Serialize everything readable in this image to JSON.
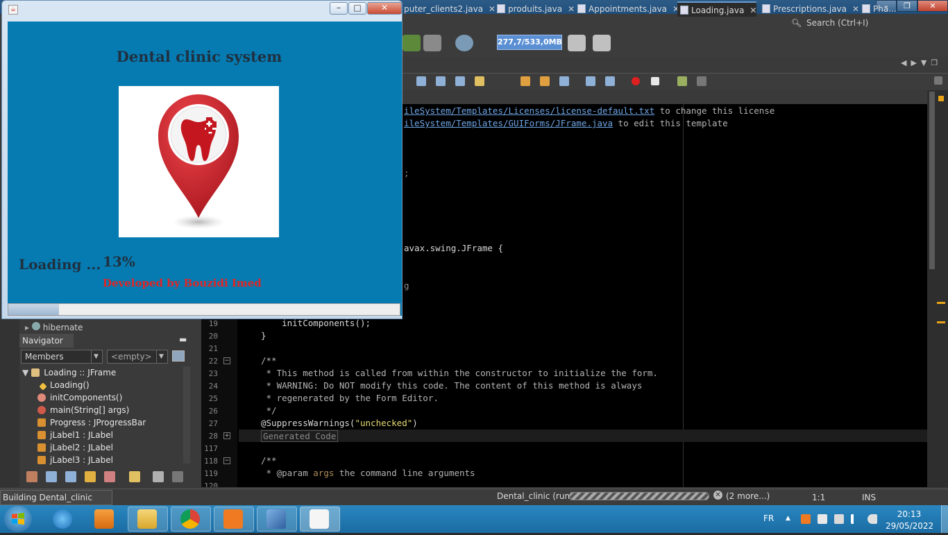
{
  "ide": {
    "search_placeholder": "Search (Ctrl+I)",
    "memory": "277,7/533,0MB",
    "tabs": [
      {
        "label": "puter_clients2.java"
      },
      {
        "label": "produits.java"
      },
      {
        "label": "Appointments.java"
      },
      {
        "label": "Loading.java"
      },
      {
        "label": "Prescriptions.java"
      },
      {
        "label": "Pha..."
      }
    ],
    "code_lines": {
      "l1_link": "ileSystem/Templates/Licenses/license-default.txt",
      "l1_rest": " to change this license",
      "l2_link": "ileSystem/Templates/GUIForms/JFrame.java",
      "l2_rest": " to edit this template",
      "l3": ";",
      "l4": "avax.swing.JFrame {",
      "l5": "g",
      "l19": "    initComponents();",
      "l20": "}",
      "l22": "/**",
      "l23": " * This method is called from within the constructor to initialize the form.",
      "l24": " * WARNING: Do NOT modify this code. The content of this method is always",
      "l25": " * regenerated by the Form Editor.",
      "l26": " */",
      "l27_a": "@SuppressWarnings(",
      "l27_str": "\"unchecked\"",
      "l27_b": ")",
      "l28": "Generated Code",
      "l118": "/**",
      "l119_a": " * @param ",
      "l119_b": "args",
      "l119_c": " the command line arguments",
      "l120": " */"
    },
    "line_numbers": [
      "19",
      "20",
      "21",
      "22",
      "23",
      "24",
      "25",
      "26",
      "27",
      "28",
      "117",
      "118",
      "119",
      "120"
    ],
    "hibernate_label": "hibernate",
    "navigator": {
      "tab_label": "Navigator",
      "members_combo": "Members",
      "filter_combo": "<empty>",
      "tree": [
        {
          "name": "Loading",
          "type": " :: JFrame"
        },
        {
          "name": "Loading()",
          "type": ""
        },
        {
          "name": "initComponents()",
          "type": ""
        },
        {
          "name": "main(String[] args)",
          "type": ""
        },
        {
          "name": "Progress",
          "type": " : JProgressBar"
        },
        {
          "name": "jLabel1",
          "type": " : JLabel"
        },
        {
          "name": "jLabel2",
          "type": " : JLabel"
        },
        {
          "name": "jLabel3",
          "type": " : JLabel"
        }
      ]
    },
    "status": {
      "left": "Building Dental_clinic (run)...",
      "run_label": "Dental_clinic (run)",
      "more": "(2 more...)",
      "caret": "1:1",
      "mode": "INS"
    }
  },
  "loading_window": {
    "title": "Dental clinic system",
    "loading_label": "Loading ...",
    "percent_text": "13%",
    "progress_value": 0.13,
    "developer": "Developed by Bouzidi Imed"
  },
  "taskbar": {
    "language": "FR",
    "time": "20:13",
    "date": "29/05/2022"
  },
  "colors": {
    "loading_bg": "#057bb1",
    "developer_text": "#e02424",
    "pin_red": "#d61f26"
  }
}
